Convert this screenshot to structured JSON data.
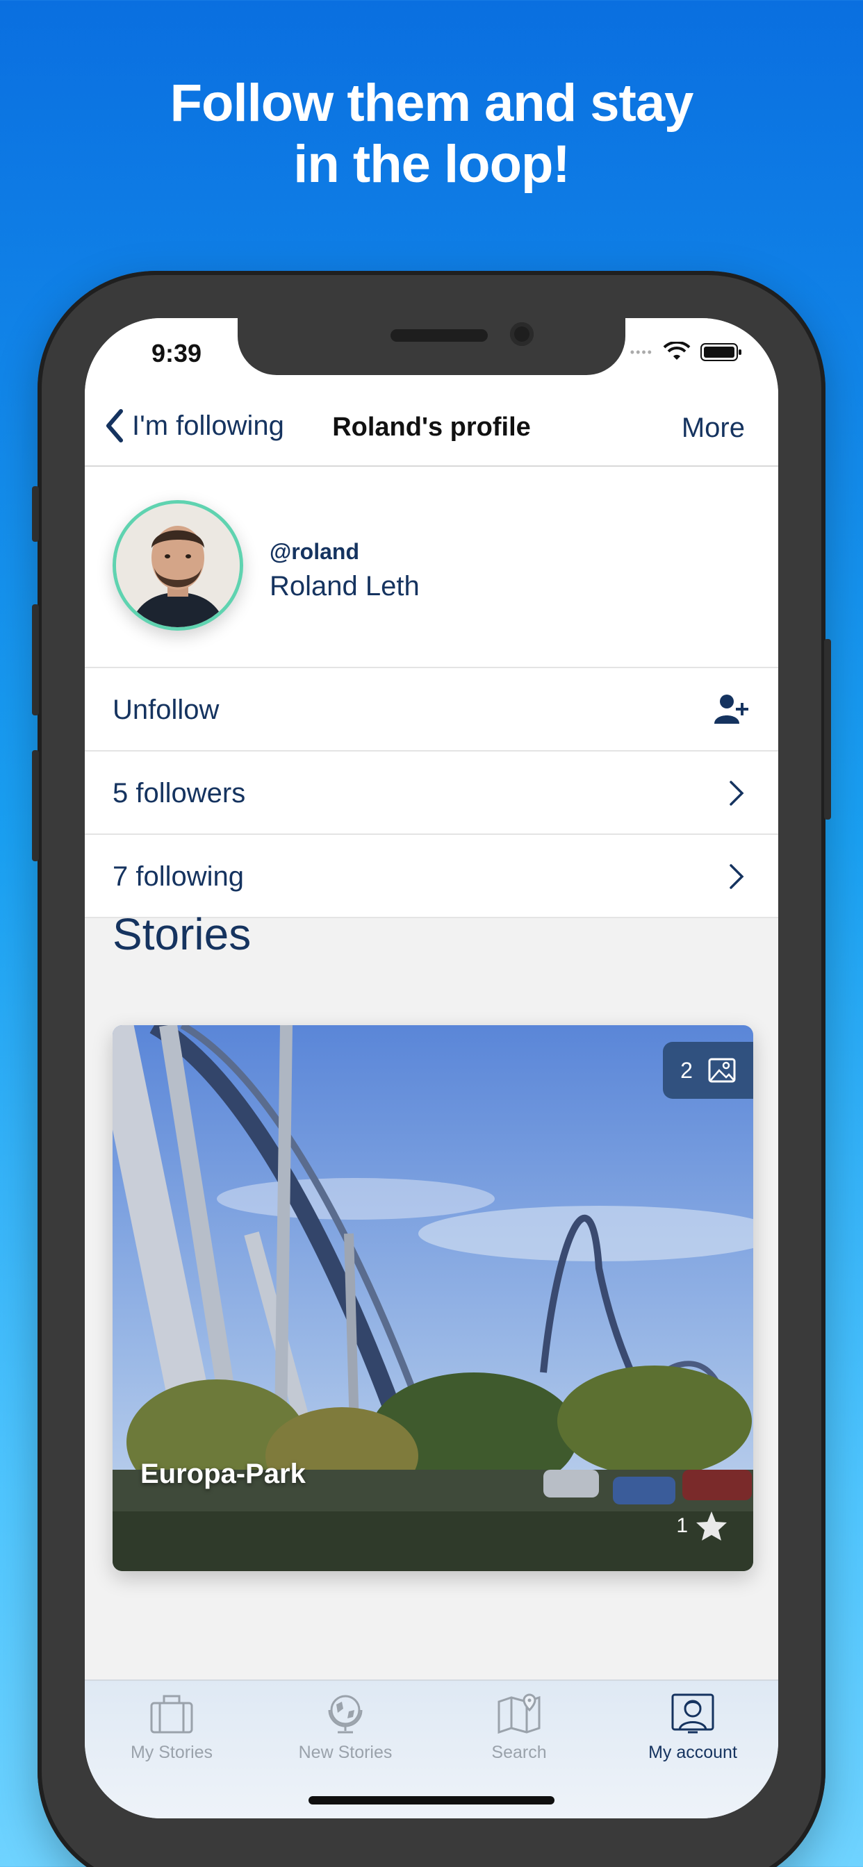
{
  "promo": {
    "headline_line1": "Follow them and stay",
    "headline_line2": "in the loop!"
  },
  "status_bar": {
    "time": "9:39"
  },
  "nav": {
    "back_label": "I'm following",
    "title": "Roland's profile",
    "more_label": "More"
  },
  "profile": {
    "handle": "@roland",
    "name": "Roland Leth"
  },
  "actions": {
    "unfollow_label": "Unfollow",
    "followers_label": "5 followers",
    "following_label": "7 following"
  },
  "stories": {
    "section_title": "Stories",
    "items": [
      {
        "title": "Europa-Park",
        "photo_count": "2",
        "favorites_count": "1"
      }
    ]
  },
  "tabbar": {
    "items": [
      {
        "label": "My Stories",
        "icon": "suitcase-icon"
      },
      {
        "label": "New Stories",
        "icon": "globe-icon"
      },
      {
        "label": "Search",
        "icon": "map-pin-icon"
      },
      {
        "label": "My account",
        "icon": "account-icon"
      }
    ],
    "active_index": 3
  },
  "colors": {
    "brand_navy": "#15335f",
    "avatar_ring": "#5fd3b0",
    "background_top": "#0a6fe0",
    "background_bottom": "#6fd3ff"
  }
}
